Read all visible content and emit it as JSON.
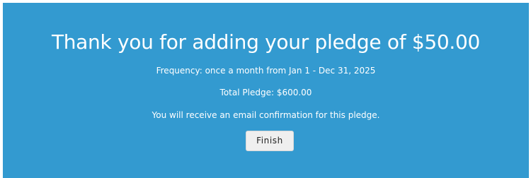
{
  "confirmation": {
    "title": "Thank you for adding your pledge of $50.00",
    "frequency_text": "Frequency: once a month from Jan 1 - Dec 31, 2025",
    "total_text": "Total Pledge: $600.00",
    "email_notice": "You will receive an email confirmation for this pledge.",
    "finish_label": "Finish"
  },
  "colors": {
    "panel_background": "#339ad0",
    "text": "#ffffff",
    "button_background": "#efefef"
  }
}
